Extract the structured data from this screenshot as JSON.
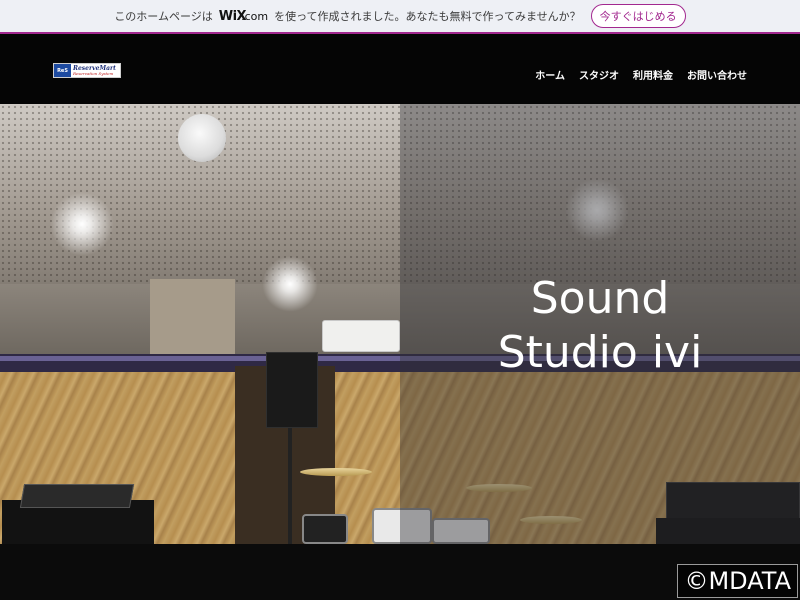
{
  "wix_banner": {
    "text_before": "このホームページは",
    "brand": "WiX",
    "brand_suffix": ".com",
    "text_after": "を使って作成されました。あなたも無料で作ってみませんか？",
    "cta": "今すぐはじめる",
    "accent_color": "#a2288f"
  },
  "header": {
    "logo": {
      "mark": "ReS",
      "title": "ReserveMart",
      "subtitle": "Reservation System"
    },
    "nav": [
      "ホーム",
      "スタジオ",
      "利用料金",
      "お問い合わせ"
    ]
  },
  "hero": {
    "title_line1": "Sound",
    "title_line2": "Studio ivi"
  },
  "watermark": "©MDATA"
}
